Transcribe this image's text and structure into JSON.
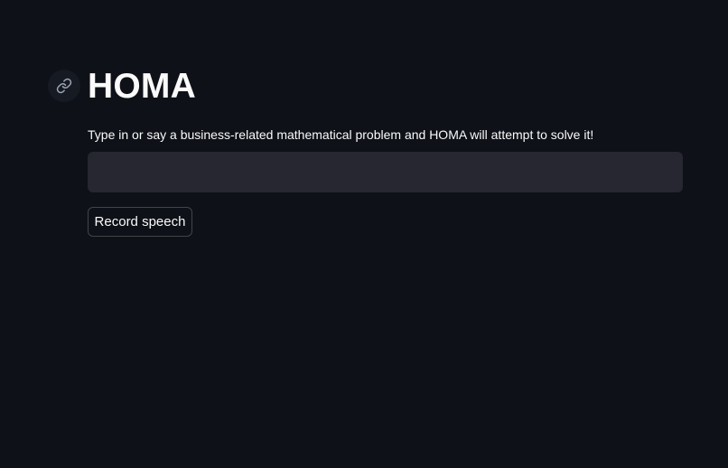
{
  "header": {
    "title": "HOMA",
    "anchor_icon": "link-icon"
  },
  "problem_input": {
    "label": "Type in or say a business-related mathematical problem and HOMA will attempt to solve it!",
    "value": "",
    "placeholder": ""
  },
  "record_button": {
    "label": "Record speech"
  },
  "colors": {
    "background": "#0e1117",
    "input_background": "#262730",
    "text": "#fafafa",
    "icon": "#9da5b4"
  }
}
